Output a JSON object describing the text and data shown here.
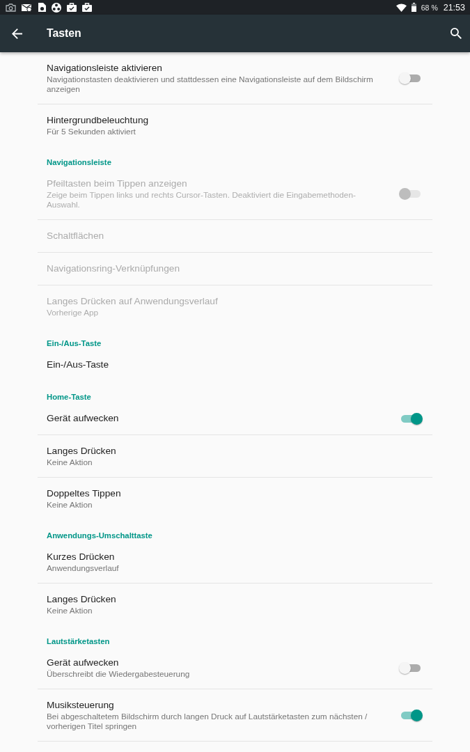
{
  "status_bar": {
    "battery": "68 %",
    "time": "21:53"
  },
  "toolbar": {
    "title": "Tasten"
  },
  "sections": [
    {
      "items": [
        {
          "kind": "switch",
          "title": "Navigationsleiste aktivieren",
          "summary": "Navigationstasten deaktivieren und stattdessen eine Navigationsleiste auf dem Bildschirm anzeigen",
          "disabled": false,
          "on": false
        },
        {
          "kind": "plain",
          "title": "Hintergrundbeleuchtung",
          "summary": "Für 5 Sekunden aktiviert",
          "disabled": false
        }
      ]
    },
    {
      "header": "Navigationsleiste",
      "items": [
        {
          "kind": "switch",
          "title": "Pfeiltasten beim Tippen anzeigen",
          "summary": "Zeige beim Tippen links und rechts Cursor-Tasten. Deaktiviert die Eingabemethoden-Auswahl.",
          "disabled": true,
          "on": false
        },
        {
          "kind": "plain",
          "title": "Schaltflächen",
          "disabled": true
        },
        {
          "kind": "plain",
          "title": "Navigationsring-Verknüpfungen",
          "disabled": true
        },
        {
          "kind": "plain",
          "title": "Langes Drücken auf Anwendungsverlauf",
          "summary": "Vorherige App",
          "disabled": true
        }
      ]
    },
    {
      "header": "Ein-/Aus-Taste",
      "items": [
        {
          "kind": "plain",
          "title": "Ein-/Aus-Taste",
          "disabled": false
        }
      ]
    },
    {
      "header": "Home-Taste",
      "items": [
        {
          "kind": "switch",
          "title": "Gerät aufwecken",
          "disabled": false,
          "on": true
        },
        {
          "kind": "plain",
          "title": "Langes Drücken",
          "summary": "Keine Aktion",
          "disabled": false
        },
        {
          "kind": "plain",
          "title": "Doppeltes Tippen",
          "summary": "Keine Aktion",
          "disabled": false
        }
      ]
    },
    {
      "header": "Anwendungs-Umschalttaste",
      "items": [
        {
          "kind": "plain",
          "title": "Kurzes Drücken",
          "summary": "Anwendungsverlauf",
          "disabled": false
        },
        {
          "kind": "plain",
          "title": "Langes Drücken",
          "summary": "Keine Aktion",
          "disabled": false
        }
      ]
    },
    {
      "header": "Lautstärketasten",
      "items": [
        {
          "kind": "switch",
          "title": "Gerät aufwecken",
          "summary": "Überschreibt die Wiedergabesteuerung",
          "disabled": false,
          "on": false
        },
        {
          "kind": "switch",
          "title": "Musiksteuerung",
          "summary": "Bei abgeschaltetem Bildschirm durch langen Druck auf Lautstärketasten zum nächsten / vorherigen Titel springen",
          "disabled": false,
          "on": true
        }
      ]
    }
  ]
}
